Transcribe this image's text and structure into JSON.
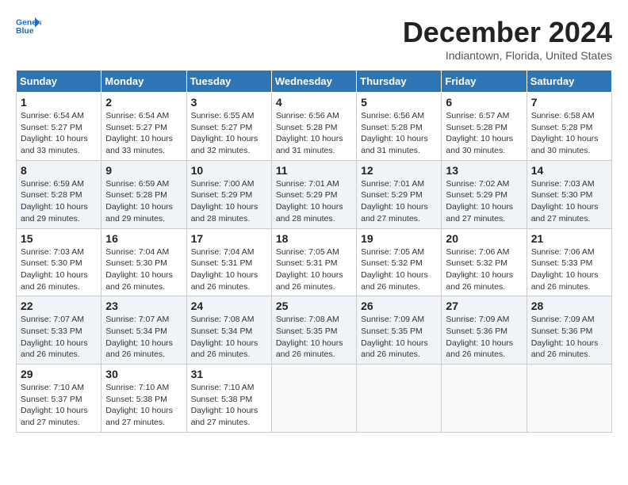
{
  "header": {
    "logo_line1": "General",
    "logo_line2": "Blue",
    "month": "December 2024",
    "location": "Indiantown, Florida, United States"
  },
  "days_of_week": [
    "Sunday",
    "Monday",
    "Tuesday",
    "Wednesday",
    "Thursday",
    "Friday",
    "Saturday"
  ],
  "weeks": [
    [
      {
        "day": "1",
        "info": "Sunrise: 6:54 AM\nSunset: 5:27 PM\nDaylight: 10 hours\nand 33 minutes."
      },
      {
        "day": "2",
        "info": "Sunrise: 6:54 AM\nSunset: 5:27 PM\nDaylight: 10 hours\nand 33 minutes."
      },
      {
        "day": "3",
        "info": "Sunrise: 6:55 AM\nSunset: 5:27 PM\nDaylight: 10 hours\nand 32 minutes."
      },
      {
        "day": "4",
        "info": "Sunrise: 6:56 AM\nSunset: 5:28 PM\nDaylight: 10 hours\nand 31 minutes."
      },
      {
        "day": "5",
        "info": "Sunrise: 6:56 AM\nSunset: 5:28 PM\nDaylight: 10 hours\nand 31 minutes."
      },
      {
        "day": "6",
        "info": "Sunrise: 6:57 AM\nSunset: 5:28 PM\nDaylight: 10 hours\nand 30 minutes."
      },
      {
        "day": "7",
        "info": "Sunrise: 6:58 AM\nSunset: 5:28 PM\nDaylight: 10 hours\nand 30 minutes."
      }
    ],
    [
      {
        "day": "8",
        "info": "Sunrise: 6:59 AM\nSunset: 5:28 PM\nDaylight: 10 hours\nand 29 minutes."
      },
      {
        "day": "9",
        "info": "Sunrise: 6:59 AM\nSunset: 5:28 PM\nDaylight: 10 hours\nand 29 minutes."
      },
      {
        "day": "10",
        "info": "Sunrise: 7:00 AM\nSunset: 5:29 PM\nDaylight: 10 hours\nand 28 minutes."
      },
      {
        "day": "11",
        "info": "Sunrise: 7:01 AM\nSunset: 5:29 PM\nDaylight: 10 hours\nand 28 minutes."
      },
      {
        "day": "12",
        "info": "Sunrise: 7:01 AM\nSunset: 5:29 PM\nDaylight: 10 hours\nand 27 minutes."
      },
      {
        "day": "13",
        "info": "Sunrise: 7:02 AM\nSunset: 5:29 PM\nDaylight: 10 hours\nand 27 minutes."
      },
      {
        "day": "14",
        "info": "Sunrise: 7:03 AM\nSunset: 5:30 PM\nDaylight: 10 hours\nand 27 minutes."
      }
    ],
    [
      {
        "day": "15",
        "info": "Sunrise: 7:03 AM\nSunset: 5:30 PM\nDaylight: 10 hours\nand 26 minutes."
      },
      {
        "day": "16",
        "info": "Sunrise: 7:04 AM\nSunset: 5:30 PM\nDaylight: 10 hours\nand 26 minutes."
      },
      {
        "day": "17",
        "info": "Sunrise: 7:04 AM\nSunset: 5:31 PM\nDaylight: 10 hours\nand 26 minutes."
      },
      {
        "day": "18",
        "info": "Sunrise: 7:05 AM\nSunset: 5:31 PM\nDaylight: 10 hours\nand 26 minutes."
      },
      {
        "day": "19",
        "info": "Sunrise: 7:05 AM\nSunset: 5:32 PM\nDaylight: 10 hours\nand 26 minutes."
      },
      {
        "day": "20",
        "info": "Sunrise: 7:06 AM\nSunset: 5:32 PM\nDaylight: 10 hours\nand 26 minutes."
      },
      {
        "day": "21",
        "info": "Sunrise: 7:06 AM\nSunset: 5:33 PM\nDaylight: 10 hours\nand 26 minutes."
      }
    ],
    [
      {
        "day": "22",
        "info": "Sunrise: 7:07 AM\nSunset: 5:33 PM\nDaylight: 10 hours\nand 26 minutes."
      },
      {
        "day": "23",
        "info": "Sunrise: 7:07 AM\nSunset: 5:34 PM\nDaylight: 10 hours\nand 26 minutes."
      },
      {
        "day": "24",
        "info": "Sunrise: 7:08 AM\nSunset: 5:34 PM\nDaylight: 10 hours\nand 26 minutes."
      },
      {
        "day": "25",
        "info": "Sunrise: 7:08 AM\nSunset: 5:35 PM\nDaylight: 10 hours\nand 26 minutes."
      },
      {
        "day": "26",
        "info": "Sunrise: 7:09 AM\nSunset: 5:35 PM\nDaylight: 10 hours\nand 26 minutes."
      },
      {
        "day": "27",
        "info": "Sunrise: 7:09 AM\nSunset: 5:36 PM\nDaylight: 10 hours\nand 26 minutes."
      },
      {
        "day": "28",
        "info": "Sunrise: 7:09 AM\nSunset: 5:36 PM\nDaylight: 10 hours\nand 26 minutes."
      }
    ],
    [
      {
        "day": "29",
        "info": "Sunrise: 7:10 AM\nSunset: 5:37 PM\nDaylight: 10 hours\nand 27 minutes."
      },
      {
        "day": "30",
        "info": "Sunrise: 7:10 AM\nSunset: 5:38 PM\nDaylight: 10 hours\nand 27 minutes."
      },
      {
        "day": "31",
        "info": "Sunrise: 7:10 AM\nSunset: 5:38 PM\nDaylight: 10 hours\nand 27 minutes."
      },
      null,
      null,
      null,
      null
    ]
  ]
}
